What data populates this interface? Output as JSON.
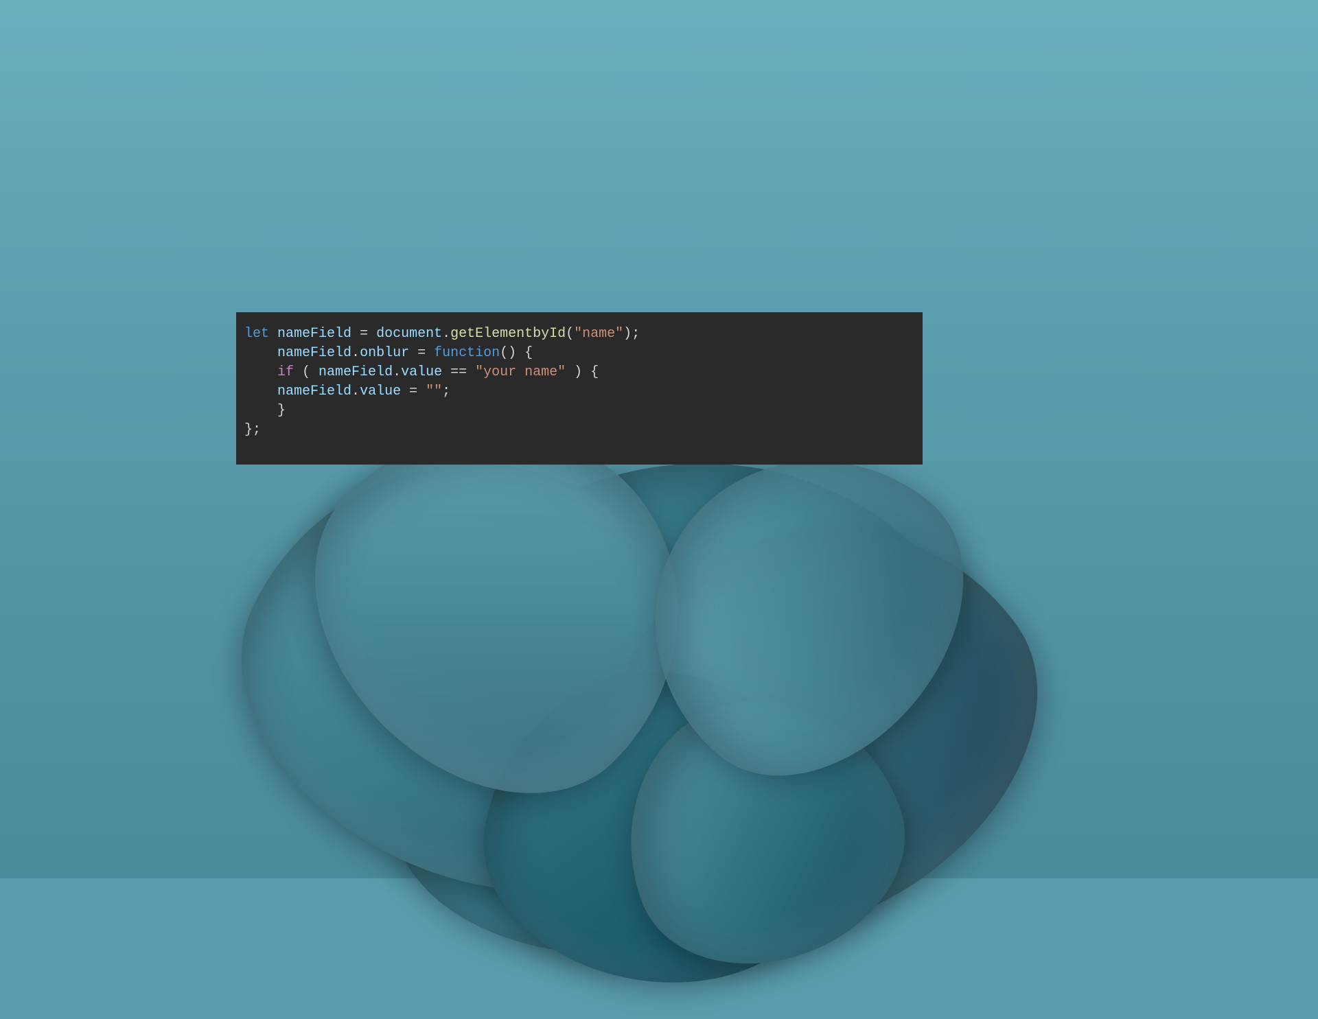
{
  "code": {
    "lines": [
      {
        "indent": 0,
        "tokens": [
          {
            "text": "let",
            "cls": "tok-keyword"
          },
          {
            "text": " ",
            "cls": "tok-default"
          },
          {
            "text": "nameField",
            "cls": "tok-variable"
          },
          {
            "text": " = ",
            "cls": "tok-default"
          },
          {
            "text": "document",
            "cls": "tok-object"
          },
          {
            "text": ".",
            "cls": "tok-dot"
          },
          {
            "text": "getElementbyId",
            "cls": "tok-method"
          },
          {
            "text": "(",
            "cls": "tok-paren"
          },
          {
            "text": "\"name\"",
            "cls": "tok-string"
          },
          {
            "text": ")",
            "cls": "tok-paren"
          },
          {
            "text": ";",
            "cls": "tok-semicolon"
          }
        ]
      },
      {
        "indent": 1,
        "tokens": [
          {
            "text": "nameField",
            "cls": "tok-object"
          },
          {
            "text": ".",
            "cls": "tok-dot"
          },
          {
            "text": "onblur",
            "cls": "tok-variable"
          },
          {
            "text": " = ",
            "cls": "tok-default"
          },
          {
            "text": "function",
            "cls": "tok-function"
          },
          {
            "text": "() {",
            "cls": "tok-paren"
          }
        ]
      },
      {
        "indent": 1,
        "tokens": [
          {
            "text": "if",
            "cls": "tok-control"
          },
          {
            "text": " ( ",
            "cls": "tok-paren"
          },
          {
            "text": "nameField",
            "cls": "tok-object"
          },
          {
            "text": ".",
            "cls": "tok-dot"
          },
          {
            "text": "value",
            "cls": "tok-variable"
          },
          {
            "text": " == ",
            "cls": "tok-default"
          },
          {
            "text": "\"your name\"",
            "cls": "tok-string"
          },
          {
            "text": " ) {",
            "cls": "tok-paren"
          }
        ]
      },
      {
        "indent": 1,
        "tokens": [
          {
            "text": "nameField",
            "cls": "tok-object"
          },
          {
            "text": ".",
            "cls": "tok-dot"
          },
          {
            "text": "value",
            "cls": "tok-variable"
          },
          {
            "text": " = ",
            "cls": "tok-default"
          },
          {
            "text": "\"\"",
            "cls": "tok-string"
          },
          {
            "text": ";",
            "cls": "tok-semicolon"
          }
        ]
      },
      {
        "indent": 1,
        "tokens": [
          {
            "text": "}",
            "cls": "tok-brace"
          }
        ]
      },
      {
        "indent": 0,
        "tokens": [
          {
            "text": "};",
            "cls": "tok-brace"
          }
        ]
      }
    ]
  },
  "colors": {
    "editor_bg": "#2a2a2a",
    "wallpaper_base": "#5a9cad"
  }
}
